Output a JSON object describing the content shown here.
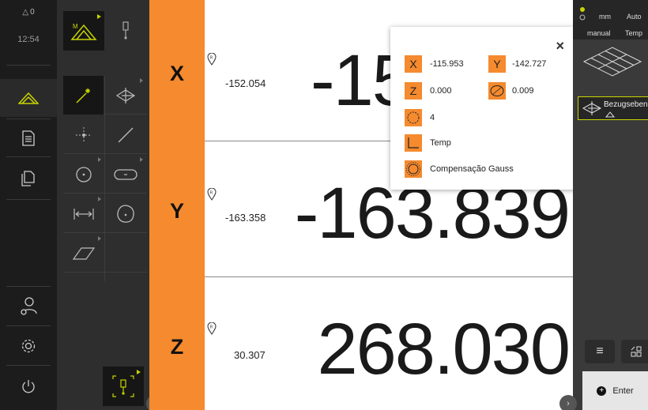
{
  "status": {
    "messages_count": "0",
    "clock": "12:54"
  },
  "axes": [
    {
      "axis": "X",
      "value_small": "-152.054",
      "value_large": "-15"
    },
    {
      "axis": "Y",
      "value_small": "-163.358",
      "value_large": "-163.839"
    },
    {
      "axis": "Z",
      "value_small": "30.307",
      "value_large": "268.030"
    }
  ],
  "popup": {
    "x": "-115.953",
    "y": "-142.727",
    "z": "0.000",
    "flatness": "0.009",
    "points": "4",
    "reference": "Temp",
    "compensation": "Compensação Gauss",
    "chip_x": "X",
    "chip_y": "Y",
    "chip_z": "Z",
    "close": "×"
  },
  "right_panel": {
    "unit": "mm",
    "mode": "Auto",
    "measure_mode": "manual",
    "reference": "Temp",
    "feature_label": "Bezugsebene",
    "enter_label": "Enter"
  },
  "colors": {
    "accent": "#F58A2E",
    "selection": "#C8D400",
    "dark": "#1C1C1C"
  },
  "icons": {
    "nav": [
      "messages-icon",
      "measure-icon",
      "document-icon",
      "files-icon",
      "user-settings-icon",
      "settings-icon",
      "power-icon"
    ],
    "tools": [
      "auto-detect-icon",
      "plane-icon",
      "point-icon",
      "line-icon",
      "circle-icon",
      "slot-icon",
      "distance-icon",
      "blob-icon",
      "rectangle-icon"
    ]
  }
}
